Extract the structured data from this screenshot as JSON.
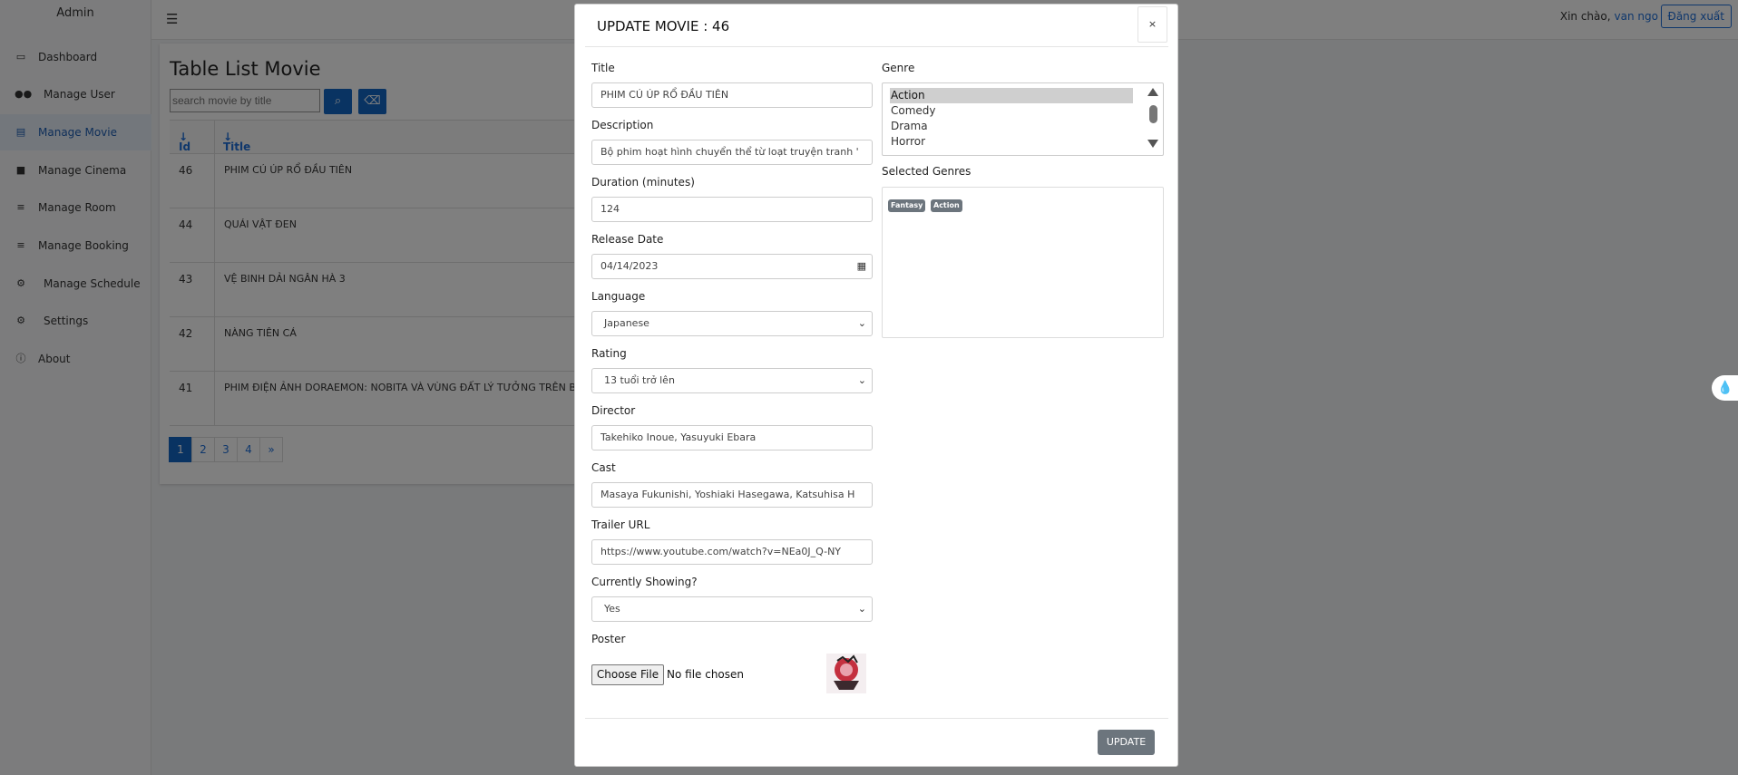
{
  "sidebar": {
    "brand": "Admin",
    "items": [
      {
        "label": "Dashboard",
        "icon": "monitor-icon"
      },
      {
        "label": "Manage User",
        "icon": "users-icon"
      },
      {
        "label": "Manage Movie",
        "icon": "film-icon",
        "active": true
      },
      {
        "label": "Manage Cinema",
        "icon": "video-camera-icon"
      },
      {
        "label": "Manage Room",
        "icon": "database-icon"
      },
      {
        "label": "Manage Booking",
        "icon": "database-icon"
      },
      {
        "label": "Manage Schedule",
        "icon": "cogs-icon"
      },
      {
        "label": "Settings",
        "icon": "cogs-icon"
      },
      {
        "label": "About",
        "icon": "info-icon"
      }
    ]
  },
  "topbar": {
    "greeting": "Xin chào,",
    "username": "van ngo",
    "logout_label": "Đăng xuất"
  },
  "movie_list": {
    "title": "Table List Movie",
    "search_placeholder": "search movie by title",
    "columns": [
      "Id",
      "Title"
    ],
    "rows": [
      {
        "id": "46",
        "title": "PHIM CÚ ÚP RỔ ĐẦU TIÊN"
      },
      {
        "id": "44",
        "title": "QUÁI VẬT ĐEN"
      },
      {
        "id": "43",
        "title": "VỆ BINH DẢI NGÂN HÀ 3"
      },
      {
        "id": "42",
        "title": "NÀNG TIÊN CÁ"
      },
      {
        "id": "41",
        "title": "PHIM ĐIỆN ẢNH DORAEMON: NOBITA VÀ VÙNG ĐẤT LÝ TƯỞNG TRÊN BẦ"
      }
    ],
    "pages": [
      "1",
      "2",
      "3",
      "4",
      "»"
    ],
    "current_page": "1"
  },
  "modal": {
    "title": "UPDATE MOVIE : 46",
    "close_label": "×",
    "fields": {
      "title": {
        "label": "Title",
        "value": "PHIM CÚ ÚP RỔ ĐẦU TIÊN"
      },
      "description": {
        "label": "Description",
        "value": "Bộ phim hoạt hình chuyển thể từ loạt truyện tranh '"
      },
      "duration": {
        "label": "Duration (minutes)",
        "value": "124"
      },
      "release_date": {
        "label": "Release Date",
        "value": "04/14/2023"
      },
      "language": {
        "label": "Language",
        "value": "Japanese"
      },
      "rating": {
        "label": "Rating",
        "value": "13 tuổi trở lên"
      },
      "director": {
        "label": "Director",
        "value": "Takehiko Inoue, Yasuyuki Ebara"
      },
      "cast": {
        "label": "Cast",
        "value": "Masaya Fukunishi, Yoshiaki Hasegawa, Katsuhisa H"
      },
      "trailer": {
        "label": "Trailer URL",
        "value": "https://www.youtube.com/watch?v=NEa0J_Q-NY"
      },
      "showing": {
        "label": "Currently Showing?",
        "value": "Yes"
      },
      "poster": {
        "label": "Poster",
        "button_label": "Choose File",
        "file_text": "No file chosen"
      }
    },
    "genre": {
      "label": "Genre",
      "options": [
        "Action",
        "Comedy",
        "Drama",
        "Horror"
      ],
      "selected_option": "Action"
    },
    "selected_genres": {
      "label": "Selected Genres",
      "badges": [
        "Fantasy",
        "Action"
      ]
    },
    "update_label": "UPDATE"
  }
}
